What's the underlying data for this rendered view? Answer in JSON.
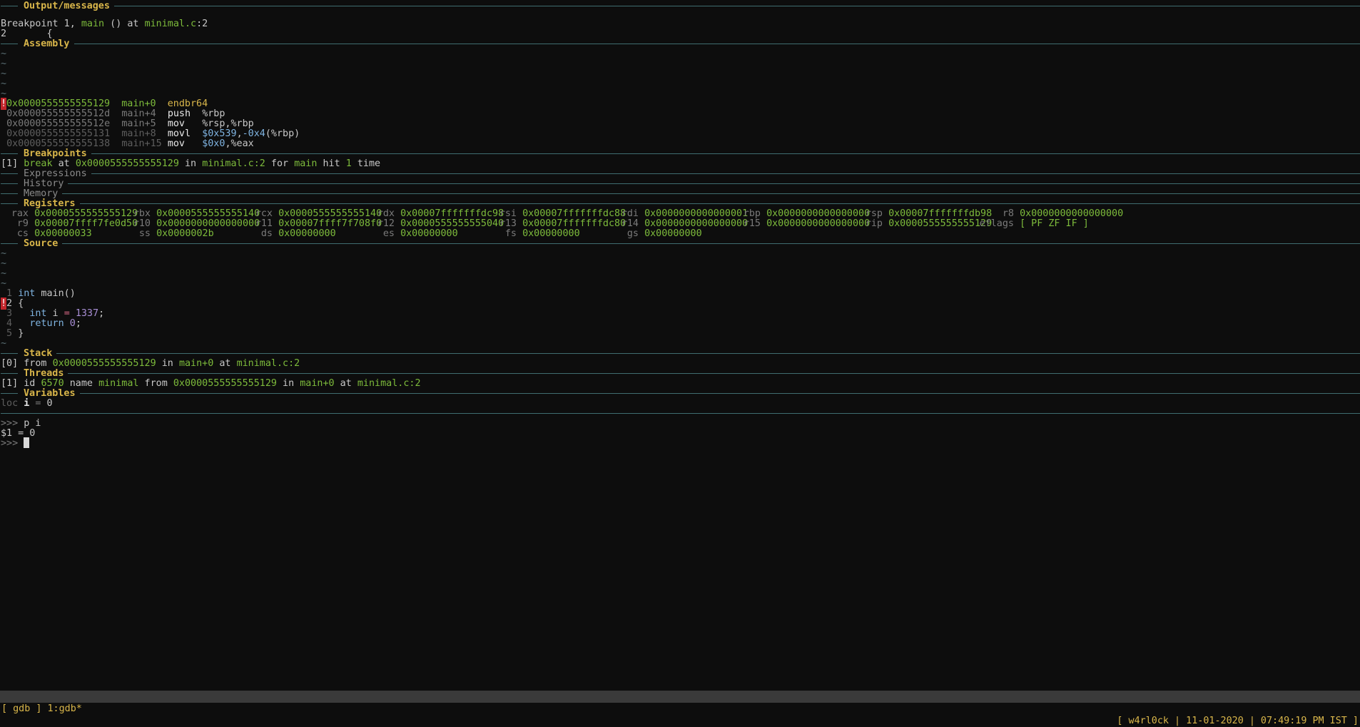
{
  "sections": {
    "output": "Output/messages",
    "assembly": "Assembly",
    "breakpoints": "Breakpoints",
    "expressions": "Expressions",
    "history": "History",
    "memory": "Memory",
    "registers": "Registers",
    "source": "Source",
    "stack": "Stack",
    "threads": "Threads",
    "variables": "Variables"
  },
  "output": {
    "line1_prefix": "Breakpoint 1, ",
    "line1_func": "main",
    "line1_mid": " () at ",
    "line1_file": "minimal.c",
    "line1_suffix": ":2",
    "line2": "2       {"
  },
  "assembly": [
    {
      "marker": "!",
      "addr": "0x0000555555555129",
      "off": "main+0 ",
      "instr": "endbr64",
      "args": ""
    },
    {
      "marker": "",
      "addr": "0x000055555555512d",
      "off": "main+4 ",
      "instr": "push  ",
      "args": "%rbp"
    },
    {
      "marker": "",
      "addr": "0x000055555555512e",
      "off": "main+5 ",
      "instr": "mov   ",
      "args": "%rsp,%rbp"
    },
    {
      "marker": "",
      "addr": "0x0000555555555131",
      "off": "main+8 ",
      "instr": "movl  ",
      "args": "$0x539,-0x4(%rbp)"
    },
    {
      "marker": "",
      "addr": "0x0000555555555138",
      "off": "main+15",
      "instr": "mov   ",
      "args": "$0x0,%eax"
    }
  ],
  "breakpoint": {
    "idx": "[1]",
    "kind": "break",
    "at": " at ",
    "addr": "0x0000555555555129",
    "in": " in ",
    "loc": "minimal.c:2",
    "for": " for ",
    "func": "main",
    "hit": " hit ",
    "count": "1",
    "time": " time"
  },
  "registers": [
    [
      {
        "name": "rax",
        "value": "0x0000555555555129"
      },
      {
        "name": "rbx",
        "value": "0x0000555555555140"
      },
      {
        "name": "rcx",
        "value": "0x0000555555555140"
      },
      {
        "name": "rdx",
        "value": "0x00007fffffffdc98"
      },
      {
        "name": "rsi",
        "value": "0x00007fffffffdc88"
      },
      {
        "name": "rdi",
        "value": "0x0000000000000001"
      },
      {
        "name": "rbp",
        "value": "0x0000000000000000"
      },
      {
        "name": "rsp",
        "value": "0x00007fffffffdb98"
      },
      {
        "name": "r8",
        "value": "0x0000000000000000"
      }
    ],
    [
      {
        "name": "r9",
        "value": "0x00007ffff7fe0d50"
      },
      {
        "name": "r10",
        "value": "0x0000000000000000"
      },
      {
        "name": "r11",
        "value": "0x00007ffff7f708f0"
      },
      {
        "name": "r12",
        "value": "0x0000555555555040"
      },
      {
        "name": "r13",
        "value": "0x00007fffffffdc80"
      },
      {
        "name": "r14",
        "value": "0x0000000000000000"
      },
      {
        "name": "r15",
        "value": "0x0000000000000000"
      },
      {
        "name": "rip",
        "value": "0x0000555555555129"
      },
      {
        "name": "eflags",
        "value": "[ PF ZF IF ]"
      }
    ],
    [
      {
        "name": "cs",
        "value": "0x00000033"
      },
      {
        "name": "ss",
        "value": "0x0000002b"
      },
      {
        "name": "ds",
        "value": "0x00000000"
      },
      {
        "name": "es",
        "value": "0x00000000"
      },
      {
        "name": "fs",
        "value": "0x00000000"
      },
      {
        "name": "gs",
        "value": "0x00000000"
      }
    ]
  ],
  "source": [
    {
      "num": "1",
      "marker": "",
      "parts": [
        [
          "key",
          "int"
        ],
        [
          "plain",
          " main()"
        ]
      ]
    },
    {
      "num": "2",
      "marker": "!",
      "parts": [
        [
          "plain",
          "{"
        ]
      ]
    },
    {
      "num": "3",
      "marker": "",
      "parts": [
        [
          "plain",
          "  "
        ],
        [
          "key",
          "int"
        ],
        [
          "plain",
          " i "
        ],
        [
          "op",
          "="
        ],
        [
          "plain",
          " "
        ],
        [
          "num",
          "1337"
        ],
        [
          "plain",
          ";"
        ]
      ]
    },
    {
      "num": "4",
      "marker": "",
      "parts": [
        [
          "plain",
          "  "
        ],
        [
          "key",
          "return"
        ],
        [
          "plain",
          " "
        ],
        [
          "num",
          "0"
        ],
        [
          "plain",
          ";"
        ]
      ]
    },
    {
      "num": "5",
      "marker": "",
      "parts": [
        [
          "plain",
          "}"
        ]
      ]
    }
  ],
  "stack": {
    "idx": "[0]",
    "from": " from ",
    "addr": "0x0000555555555129",
    "in": " in ",
    "func": "main+0",
    "at": " at ",
    "loc": "minimal.c:2"
  },
  "threads": {
    "idx": "[1]",
    "id_label": " id ",
    "id": "6570",
    "name_label": " name ",
    "name": "minimal",
    "from": " from ",
    "addr": "0x0000555555555129",
    "in": " in ",
    "func": "main+0",
    "at": " at ",
    "loc": "minimal.c:2"
  },
  "variables": {
    "scope": "loc",
    "name": "i",
    "eq": " = ",
    "value": "0"
  },
  "console": {
    "prompt": ">>>",
    "cmd1": " p i",
    "result1": "$1 = 0"
  },
  "statusbar": {
    "left": "[ gdb ] 1:gdb*",
    "right": "[ w4rl0ck | 11-01-2020 | 07:49:19 PM IST ]"
  },
  "colors": {
    "background": "#0d0d0d",
    "section_title": "#d9b64a",
    "rule": "#3f6d70",
    "address_green": "#7dbb3b",
    "breakpoint_red": "#c2252b",
    "statusbar_bg": "#3a3a3a"
  }
}
